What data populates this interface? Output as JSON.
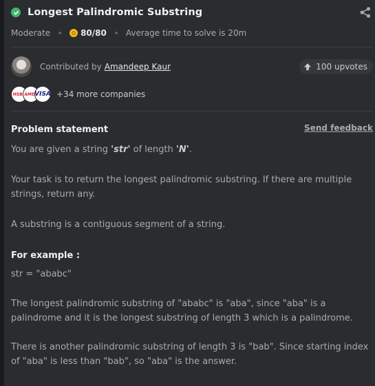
{
  "problem": {
    "title": "Longest Palindromic Substring",
    "difficulty": "Moderate",
    "score": "80/80",
    "avg_time": "Average time to solve is 20m"
  },
  "contributor": {
    "prefix": "Contributed by",
    "name": "Amandeep Kaur",
    "upvotes": "100 upvotes"
  },
  "companies": {
    "logos": [
      "HSBC",
      "AMEX",
      "VISA"
    ],
    "more": "+34 more companies"
  },
  "statement": {
    "heading": "Problem statement",
    "feedback": "Send feedback",
    "p1_pre": "You are given a string ",
    "p1_str": "'str'",
    "p1_mid": " of length ",
    "p1_n": "'N'",
    "p1_end": ".",
    "p2": "Your task is to return the longest palindromic substring. If there are multiple strings, return any.",
    "p3": "A substring is a contiguous segment of a string.",
    "example_heading": "For example :",
    "example_input": "str = \"ababc\"",
    "p4": "The longest palindromic substring of \"ababc\" is \"aba\", since \"aba\" is a palindrome and it is the longest substring of length 3 which is a palindrome.",
    "p5": "There is another palindromic substring of length 3 is \"bab\". Since starting index of \"aba\" is less than \"bab\", so \"aba\" is the answer."
  },
  "colors": {
    "success": "#3fb56d",
    "coin": "#f5b81c",
    "background": "#2b2c30"
  },
  "icons": {
    "solved": "check-circle-icon",
    "share": "share-icon",
    "coin": "coin-icon",
    "upvote": "arrow-up-icon"
  }
}
